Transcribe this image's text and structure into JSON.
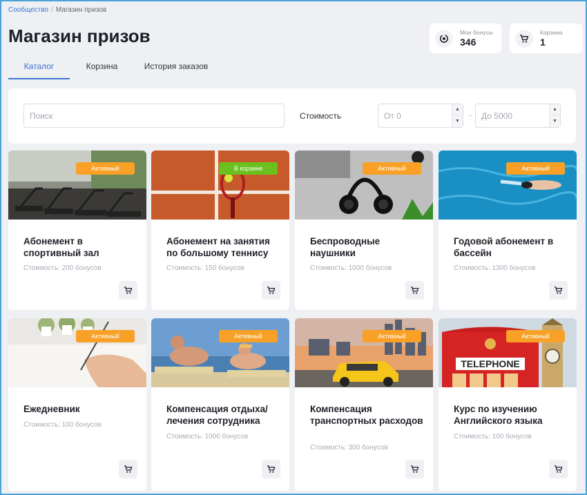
{
  "breadcrumb": {
    "root": "Сообщество",
    "separator": "/",
    "current": "Магазин призов"
  },
  "page_title": "Магазин призов",
  "stats": {
    "bonus": {
      "label": "Мои бонусы",
      "value": "346",
      "icon": "bonus-coin-icon"
    },
    "cart": {
      "label": "Корзина",
      "value": "1",
      "icon": "cart-icon"
    }
  },
  "tabs": [
    {
      "label": "Каталог",
      "active": true
    },
    {
      "label": "Корзина",
      "active": false
    },
    {
      "label": "История заказов",
      "active": false
    }
  ],
  "filter": {
    "search_placeholder": "Поиск",
    "price_label": "Стоимость",
    "from_placeholder": "От 0",
    "to_placeholder": "До 5000"
  },
  "products": [
    {
      "title": "Абонемент в спортивный зал",
      "price": "Стоимость: 200 бонусов",
      "badge": "Активный",
      "badge_type": "active",
      "image": "gym-treadmills"
    },
    {
      "title": "Абонемент на занятия по большому теннису",
      "price": "Стоимость: 150 бонусов",
      "badge": "В корзине",
      "badge_type": "incart",
      "image": "tennis-racket-clay-court"
    },
    {
      "title": "Беспроводные наушники",
      "price": "Стоимость: 1000 бонусов",
      "badge": "Активный",
      "badge_type": "active",
      "image": "headphones-laptop"
    },
    {
      "title": "Годовой абонемент в бассейн",
      "price": "Стоимость: 1300 бонусов",
      "badge": "Активный",
      "badge_type": "active",
      "image": "swimmer-pool"
    },
    {
      "title": "Ежедневник",
      "price": "Стоимость: 100 бонусов",
      "badge": "Активный",
      "badge_type": "active",
      "image": "hand-writing-notebook"
    },
    {
      "title": "Компенсация отдыха/ лечения сотрудника",
      "price": "Стоимость: 1000 бонусов",
      "badge": "Активный",
      "badge_type": "active",
      "image": "couple-sunbathing"
    },
    {
      "title": "Компенсация транспортных расходов",
      "price": "Стоимость: 300 бонусов",
      "badge": "Активный",
      "badge_type": "active",
      "image": "yellow-taxi-city"
    },
    {
      "title": "Курс по изучению Английского языка",
      "price": "Стоимость: 100 бонусов",
      "badge": "Активный",
      "badge_type": "active",
      "image": "london-telephone-box",
      "image_text": "TELEPHONE"
    }
  ],
  "colors": {
    "accent": "#3d73d6",
    "badge_active": "#f8a126",
    "badge_incart": "#6ac11d"
  }
}
